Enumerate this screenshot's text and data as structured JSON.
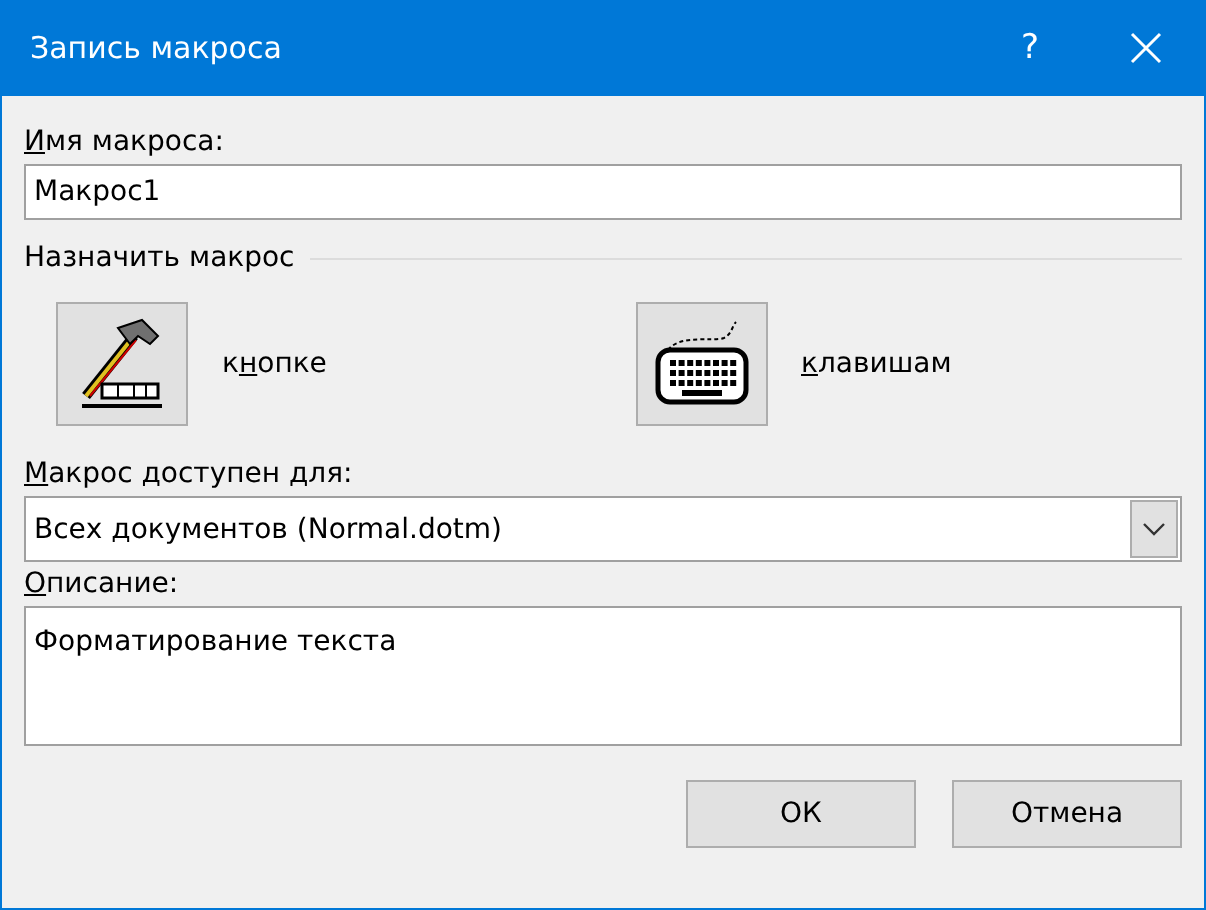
{
  "window": {
    "title": "Запись макроса",
    "help": "?"
  },
  "name_label": {
    "key": "И",
    "after": "мя макроса:"
  },
  "name_value": "Макрос1",
  "assign_group": "Назначить макрос",
  "assign_buttons": [
    {
      "kind": "button",
      "label": {
        "before": "к",
        "key": "н",
        "after": "опке"
      }
    },
    {
      "kind": "keyboard",
      "label": {
        "key": "к",
        "after": "лавишам"
      }
    }
  ],
  "store_label": {
    "key": "М",
    "after": "акрос доступен для:"
  },
  "store_value": "Всех документов (Normal.dotm)",
  "description_label": {
    "key": "О",
    "after": "писание:"
  },
  "description_value": "Форматирование текста",
  "buttons": [
    "ОК",
    "Отмена"
  ]
}
